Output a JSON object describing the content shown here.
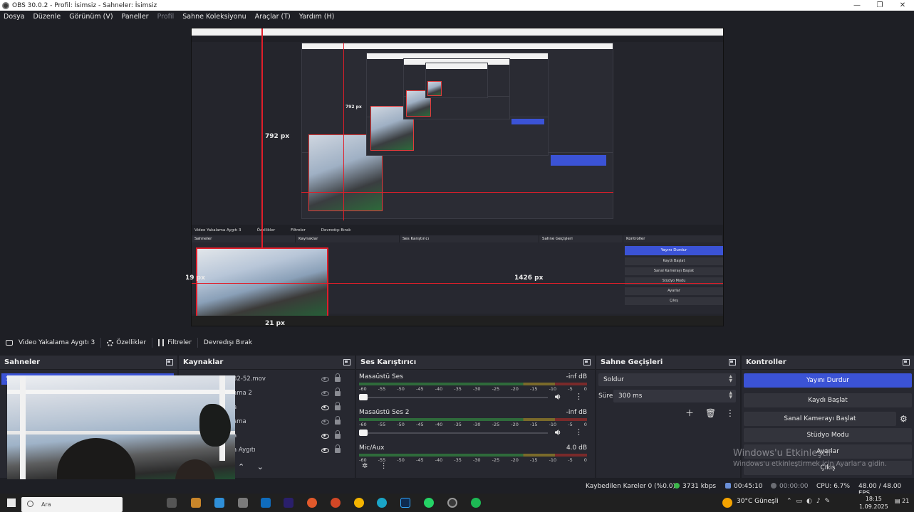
{
  "window": {
    "title": "OBS 30.0.2 - Profil: İsimsiz - Sahneler: İsimsiz",
    "controls": [
      "—",
      "❐",
      "✕"
    ]
  },
  "menu": [
    {
      "label": "Dosya"
    },
    {
      "label": "Düzenle"
    },
    {
      "label": "Görünüm (V)"
    },
    {
      "label": "Paneller"
    },
    {
      "label": "Profil"
    },
    {
      "label": "Sahne Koleksiyonu"
    },
    {
      "label": "Araçlar (T)"
    },
    {
      "label": "Yardım (H)"
    }
  ],
  "preview": {
    "guides": {
      "vertical_label": "792 px",
      "inner_vertical_label": "792 px",
      "left_label": "19 px",
      "right_label": "1426 px",
      "bottom_label": "21 px"
    },
    "inner": {
      "source_name": "Video Yakalama Aygıtı 3",
      "properties": "Özellikler",
      "filters": "Filtreler",
      "deactivate": "Devredışı Bırak",
      "docks": [
        "Sahneler",
        "Kaynaklar",
        "Ses Karıştırıcı",
        "Sahne Geçişleri",
        "Kontroller"
      ],
      "stop_stream": "Yayını Durdur",
      "start_record": "Kaydı Başlat",
      "virtual_cam": "Sanal Kamerayı Başlat",
      "studio": "Stüdyo Modu",
      "settings": "Ayarlar",
      "exit": "Çıkış"
    }
  },
  "source_toolbar": {
    "source_name": "Video Yakalama Aygıtı 3",
    "properties": "Özellikler",
    "filters": "Filtreler",
    "deactivate": "Devredışı Bırak"
  },
  "scenes": {
    "title": "Sahneler",
    "first_item": "S"
  },
  "sources": {
    "title": "Kaynaklar",
    "items": [
      {
        "name": "32-52.mov",
        "visible": false
      },
      {
        "name": "ama 2",
        "visible": false
      },
      {
        "name": "a",
        "visible": true
      },
      {
        "name": "ama",
        "visible": false
      },
      {
        "name": "a",
        "visible": true
      },
      {
        "name": "a Aygıtı",
        "visible": true
      }
    ],
    "move_up": "⌃",
    "move_down": "⌄"
  },
  "mixer": {
    "title": "Ses Karıştırıcı",
    "ticks": [
      "-60",
      "-55",
      "-50",
      "-45",
      "-40",
      "-35",
      "-30",
      "-25",
      "-20",
      "-15",
      "-10",
      "-5",
      "0"
    ],
    "channels": [
      {
        "name": "Masaüstü Ses",
        "level": "-inf dB"
      },
      {
        "name": "Masaüstü Ses 2",
        "level": "-inf dB"
      },
      {
        "name": "Mic/Aux",
        "level": "4.0 dB"
      }
    ]
  },
  "transitions": {
    "title": "Sahne Geçişleri",
    "selected": "Soldur",
    "duration_label": "Süre",
    "duration_value": "300 ms"
  },
  "controls": {
    "title": "Kontroller",
    "stop_stream": "Yayını Durdur",
    "start_record": "Kaydı Başlat",
    "virtual_cam": "Sanal Kamerayı Başlat",
    "studio_mode": "Stüdyo Modu",
    "settings": "Ayarlar",
    "exit": "Çıkış"
  },
  "activation": {
    "line1": "Windows'u Etkinleştir",
    "line2": "Windows'u etkinleştirmek için Ayarlar'a gidin."
  },
  "status": {
    "dropped": "Kaybedilen Kareler 0 (%0.0)",
    "bitrate": "3731 kbps",
    "stream_time": "00:45:10",
    "record_time": "00:00:00",
    "cpu": "CPU: 6.7%",
    "fps": "48.00 / 48.00 FPS"
  },
  "taskbar": {
    "search": "Ara",
    "weather": "30°C  Güneşli",
    "time": "18:15",
    "date": "1.09.2025",
    "notifications": "21"
  },
  "colors": {
    "accent": "#3b53d6",
    "guide": "#e01e2a",
    "bg": "#1e1f25",
    "panel": "#272830"
  }
}
